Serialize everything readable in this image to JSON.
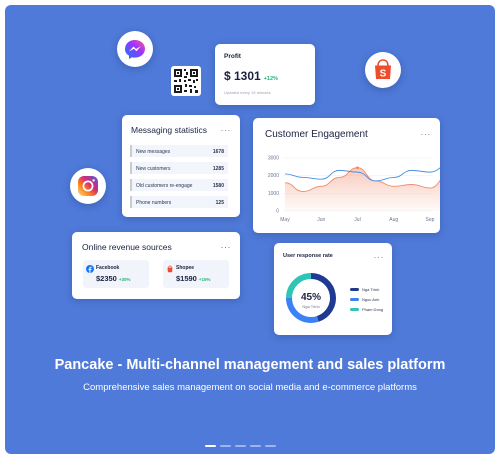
{
  "profit": {
    "title": "Profit",
    "amount": "$ 1301",
    "change": "+12%",
    "note": "Updated every 15 minutes"
  },
  "messaging": {
    "title": "Messaging statistics",
    "rows": [
      {
        "label": "New messages",
        "value": "1678",
        "color": "#3b82f6"
      },
      {
        "label": "New customers",
        "value": "1285",
        "color": "#f08a4b"
      },
      {
        "label": "Old customers re-engage",
        "value": "1580",
        "color": "#3b82f6"
      },
      {
        "label": "Phone numbers",
        "value": "125",
        "color": "#22b5a0"
      }
    ]
  },
  "engagement": {
    "title": "Customer Engagement",
    "chart_data": {
      "type": "area",
      "categories": [
        "May",
        "Jun",
        "Jul",
        "Aug",
        "Sep"
      ],
      "yticks": [
        0,
        1000,
        2000,
        3000
      ],
      "ylim": [
        0,
        3000
      ],
      "series": [
        {
          "color": "#f08a6b",
          "x": [
            0,
            0.5,
            1,
            1.5,
            2,
            2.5,
            3,
            3.5,
            4,
            4.5
          ],
          "values": [
            1600,
            1100,
            1400,
            1900,
            2450,
            1700,
            1400,
            1500,
            1300,
            2000
          ]
        },
        {
          "color": "#4a90e2",
          "x": [
            0,
            0.5,
            1,
            1.5,
            2,
            2.5,
            3,
            3.5,
            4,
            4.5
          ],
          "values": [
            2100,
            1900,
            1800,
            2300,
            2200,
            1700,
            1900,
            2300,
            2200,
            2600
          ]
        }
      ]
    }
  },
  "revenue": {
    "title": "Online revenue sources",
    "sources": [
      {
        "name": "Facebook",
        "amount": "$2350",
        "change": "+30%",
        "icon": "facebook-icon"
      },
      {
        "name": "Shopee",
        "amount": "$1590",
        "change": "+15%",
        "icon": "shopee-icon"
      }
    ]
  },
  "response": {
    "title": "User response rate",
    "percent": "45%",
    "person": "Nga Trinh",
    "chart_data": {
      "type": "pie",
      "series": [
        {
          "name": "Nga Trinh",
          "value": 45,
          "color": "#1f3a93"
        },
        {
          "name": "Ngọc Anh",
          "value": 30,
          "color": "#3b82f6"
        },
        {
          "name": "Phạm Dong",
          "value": 25,
          "color": "#2ec4b6"
        }
      ]
    }
  },
  "headline": "Pancake - Multi-channel management and sales platform",
  "subline": "Comprehensive sales management on social media and e-commerce platforms",
  "pager": {
    "count": 5,
    "active": 0
  },
  "colors": {
    "background": "#4f7ad9",
    "positive": "#22b573"
  },
  "icons": [
    "messenger-icon",
    "qr-code-icon",
    "shopee-icon",
    "instagram-icon",
    "more-icon"
  ]
}
